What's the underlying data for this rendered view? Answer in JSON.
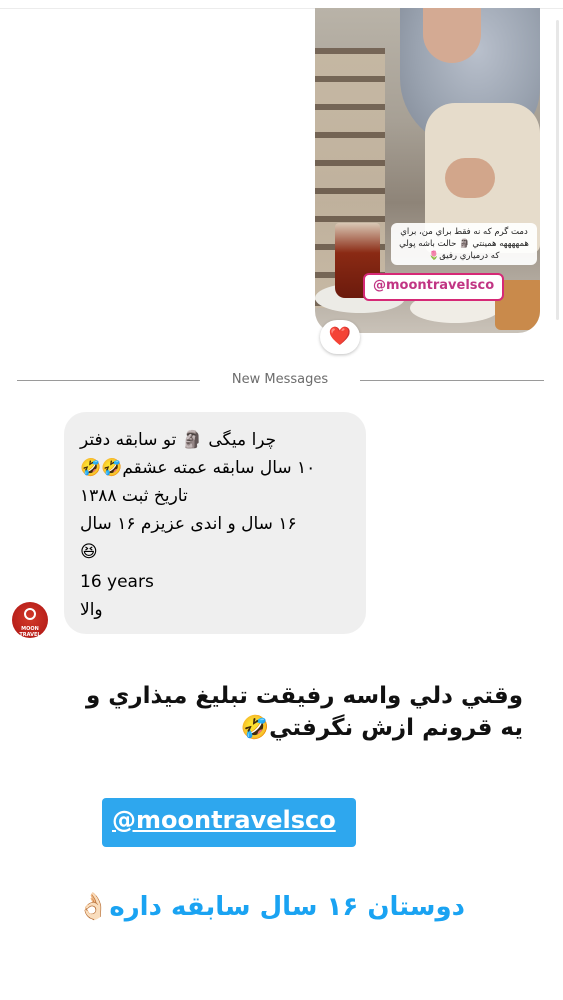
{
  "shared_post": {
    "caption": "دمت گرم که نه فقط براي من، براي همههههه همينتي 🗿 حالت باشه پولي که درمياري رفيق🌷",
    "mention_tag": "@moontravelsco"
  },
  "reaction": {
    "emoji": "❤️"
  },
  "divider": {
    "label": "New Messages"
  },
  "message": {
    "lines": [
      "چرا میگی 🗿 تو سابقه دفتر",
      "۱۰ سال سابقه عمته عشقم🤣🤣",
      "تاریخ ثبت ۱۳۸۸",
      "۱۶  سال و اندی عزیزم ۱۶ سال",
      "😆",
      "16 years",
      "والا"
    ]
  },
  "avatar": {
    "label": "MOON TRAVEL"
  },
  "story": {
    "line1": "وقتي دلي واسه رفيقت تبليغ ميذاري و",
    "line2": "يه قرونم ازش نگرفتي🤣"
  },
  "mention_sticker": {
    "label": "@moontravelsco"
  },
  "footer_text": {
    "label": "دوستان ۱۶ سال سابقه داره👌🏻"
  },
  "colors": {
    "mention_bg": "#2ea7ee",
    "bottom_text": "#1aa3f2",
    "bubble_bg": "#efefef",
    "heart": "#e0245e"
  }
}
